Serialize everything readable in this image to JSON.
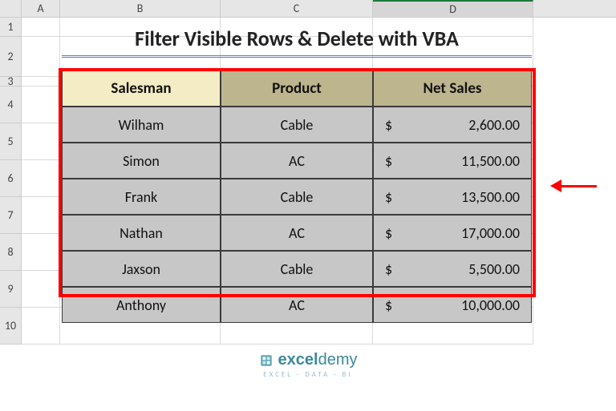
{
  "columns": {
    "A": "A",
    "B": "B",
    "C": "C",
    "D": "D"
  },
  "rows": {
    "r1": "1",
    "r2": "2",
    "r3": "3",
    "r4": "4",
    "r5": "5",
    "r6": "6",
    "r7": "7",
    "r8": "8",
    "r9": "9",
    "r10": "10"
  },
  "title": "Filter Visible Rows & Delete with VBA",
  "headers": {
    "salesman": "Salesman",
    "product": "Product",
    "netsales": "Net Sales"
  },
  "currency_symbol": "$",
  "chart_data": {
    "type": "table",
    "columns": [
      "Salesman",
      "Product",
      "Net Sales"
    ],
    "rows": [
      {
        "salesman": "Wilham",
        "product": "Cable",
        "netsales": "2,600.00"
      },
      {
        "salesman": "Simon",
        "product": "AC",
        "netsales": "11,500.00"
      },
      {
        "salesman": "Frank",
        "product": "Cable",
        "netsales": "13,500.00"
      },
      {
        "salesman": "Nathan",
        "product": "AC",
        "netsales": "17,000.00"
      },
      {
        "salesman": "Jaxson",
        "product": "Cable",
        "netsales": "5,500.00"
      },
      {
        "salesman": "Anthony",
        "product": "AC",
        "netsales": "10,000.00"
      }
    ],
    "highlighted_row_index": 2
  },
  "brand": {
    "name_bold": "excel",
    "name_rest": "demy",
    "tagline": "EXCEL · DATA · BI"
  }
}
